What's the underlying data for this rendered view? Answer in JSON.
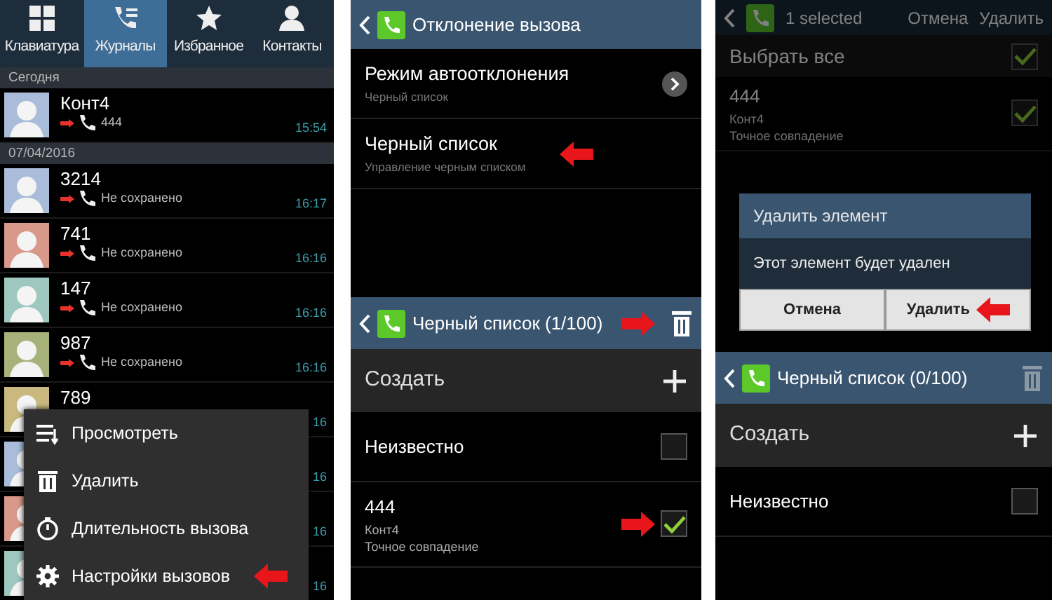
{
  "call_log": {
    "tabs": [
      {
        "label": "Клавиатура",
        "kind": "keypad",
        "selected": false
      },
      {
        "label": "Журналы",
        "kind": "logs",
        "selected": true
      },
      {
        "label": "Избранное",
        "kind": "favorites",
        "selected": false
      },
      {
        "label": "Контакты",
        "kind": "contacts",
        "selected": false
      }
    ],
    "sections": [
      {
        "header": "Сегодня",
        "rows": [
          {
            "name": "Конт4",
            "detail": "444",
            "time": "15:54",
            "color": "#a9bcd9"
          }
        ]
      },
      {
        "header": "07/04/2016",
        "rows": [
          {
            "name": "3214",
            "detail": "Не сохранено",
            "time": "16:17",
            "color": "#a9bcd9"
          },
          {
            "name": "741",
            "detail": "Не сохранено",
            "time": "16:16",
            "color": "#d9998a"
          },
          {
            "name": "147",
            "detail": "Не сохранено",
            "time": "16:16",
            "color": "#9ec7bf"
          },
          {
            "name": "987",
            "detail": "Не сохранено",
            "time": "16:16",
            "color": "#a7b27a"
          },
          {
            "name": "789",
            "time": "16",
            "color": "#c9b97e"
          },
          {
            "time": "16",
            "color": "#a9bcd9"
          },
          {
            "time": "16",
            "color": "#d9998a"
          },
          {
            "time": "16",
            "color": "#9ec7bf"
          }
        ]
      }
    ],
    "menu": [
      {
        "label": "Просмотреть",
        "kind": "view"
      },
      {
        "label": "Удалить",
        "kind": "delete"
      },
      {
        "label": "Длительность вызова",
        "kind": "duration"
      },
      {
        "label": "Настройки вызовов",
        "kind": "settings",
        "arrow_left": true
      }
    ]
  },
  "call_reject": {
    "title": "Отклонение вызова",
    "items": [
      {
        "title": "Режим автоотклонения",
        "subtitle": "Черный список",
        "kind": "submenu"
      },
      {
        "title": "Черный список",
        "subtitle": "Управление черным списком",
        "kind": "plain",
        "arrow_left": true
      }
    ],
    "blacklist": {
      "title": "Черный список (1/100)",
      "arrow_right": true,
      "delete_disabled": false,
      "create": "Создать",
      "entries": [
        {
          "title": "Неизвестно",
          "checked": false
        },
        {
          "title": "444",
          "lines": [
            "Конт4",
            "Точное совпадение"
          ],
          "checked": true,
          "arrow_right": true
        }
      ]
    }
  },
  "delete_screen": {
    "selection": {
      "count": "1 selected",
      "actions": [
        "Отмена",
        "Удалить"
      ],
      "select_all": {
        "label": "Выбрать все",
        "checked": true
      },
      "entries": [
        {
          "title": "444",
          "lines": [
            "Конт4",
            "Точное совпадение"
          ],
          "checked": true
        }
      ]
    },
    "dialog": {
      "title": "Удалить элемент",
      "message": "Этот элемент будет удален",
      "buttons": [
        {
          "label": "Отмена"
        },
        {
          "label": "Удалить",
          "arrow_left": true
        }
      ]
    },
    "blacklist": {
      "title": "Черный список (0/100)",
      "delete_disabled": true,
      "create": "Создать",
      "entries": [
        {
          "title": "Неизвестно",
          "checked": false
        }
      ]
    }
  }
}
